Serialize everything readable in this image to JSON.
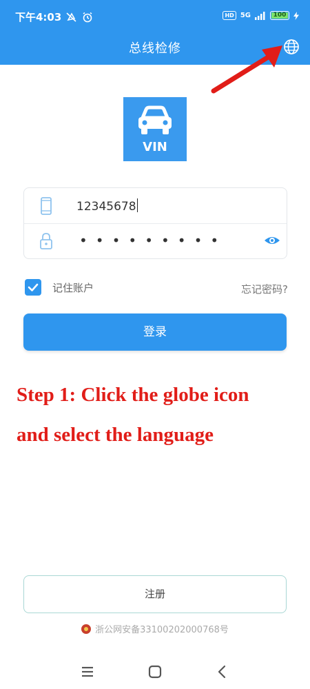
{
  "status": {
    "time": "下午4:03",
    "network": "5G",
    "hd": "HD",
    "battery": "100"
  },
  "app": {
    "title": "总线检修"
  },
  "logo": {
    "text": "VIN"
  },
  "form": {
    "phone_value": "12345678",
    "password_mask": "•••••••••"
  },
  "remember": {
    "label": "记住账户",
    "checked": true
  },
  "forgot_label": "忘记密码?",
  "login_label": "登录",
  "annotation": {
    "line1": "Step 1: Click the globe icon",
    "line2": "and select the language"
  },
  "register_label": "注册",
  "beian_text": "浙公网安备33100202000768号",
  "colors": {
    "primary": "#2f96ee",
    "annotation_red": "#e11d18"
  },
  "icons": [
    "globe-icon",
    "phone-icon",
    "lock-icon",
    "eye-icon",
    "checkbox-icon",
    "menu-icon",
    "home-icon",
    "back-icon",
    "arrow-annotation"
  ]
}
